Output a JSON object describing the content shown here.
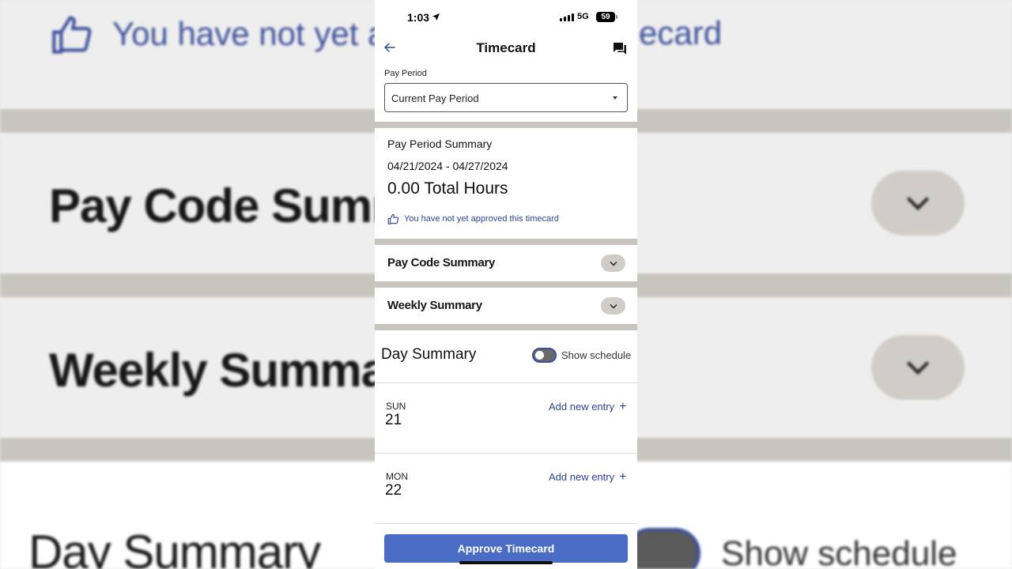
{
  "background": {
    "notice_text": "You have not yet a",
    "notice_tail": "ecard",
    "pay_code_title": "Pay Code Summ",
    "weekly_title": "Weekly Summar",
    "day_title": "Day Summary",
    "show_schedule": "Show schedule"
  },
  "status_bar": {
    "time": "1:03",
    "network": "5G",
    "battery": "59"
  },
  "nav": {
    "title": "Timecard"
  },
  "pay_period": {
    "label": "Pay Period",
    "selected": "Current Pay Period"
  },
  "summary": {
    "title": "Pay Period Summary",
    "dates": "04/21/2024 - 04/27/2024",
    "total_hours": "0.00 Total Hours",
    "approval_notice": "You have not yet approved this timecard"
  },
  "accordions": {
    "pay_code": "Pay Code Summary",
    "weekly": "Weekly Summary"
  },
  "day_summary": {
    "title": "Day Summary",
    "toggle_label": "Show schedule",
    "days": [
      {
        "dow": "SUN",
        "num": "21",
        "add_label": "Add new entry"
      },
      {
        "dow": "MON",
        "num": "22",
        "add_label": "Add new entry"
      }
    ]
  },
  "footer": {
    "approve_label": "Approve Timecard"
  },
  "colors": {
    "accent": "#4a6cc4",
    "link": "#2e4494",
    "separator": "#c8c5bf"
  }
}
